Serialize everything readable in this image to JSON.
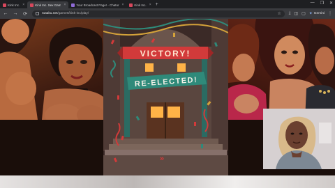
{
  "browser": {
    "tabs": [
      {
        "label": "Kink Inc.",
        "active": false
      },
      {
        "label": "Kink Inc. Sex Gam",
        "active": true
      },
      {
        "label": "Your Broadcast Page! - Chatur",
        "active": false
      },
      {
        "label": "Kink Inc.",
        "active": false
      }
    ],
    "new_tab_glyph": "+",
    "window_controls": [
      "—",
      "❐",
      "✕"
    ],
    "url_host": "nutaku.net",
    "url_path": "/games/kink-inc/play/",
    "nav_glyphs": {
      "back": "←",
      "forward": "→",
      "reload": "⟳"
    },
    "star_glyph": "☆",
    "gemini_label": "Gemini",
    "menu_glyph": "⋮"
  },
  "game": {
    "banner_top": "VICTORY!",
    "banner_bottom": "RE-ELECTED!",
    "colors": {
      "banner_red": "#d23a3a",
      "banner_teal": "#2f8a7a",
      "door": "#5a3320",
      "window_glow": "#ffb347"
    }
  },
  "icons": {
    "tab_close": "close-icon",
    "star": "star-icon",
    "gemini": "gemini-icon"
  }
}
